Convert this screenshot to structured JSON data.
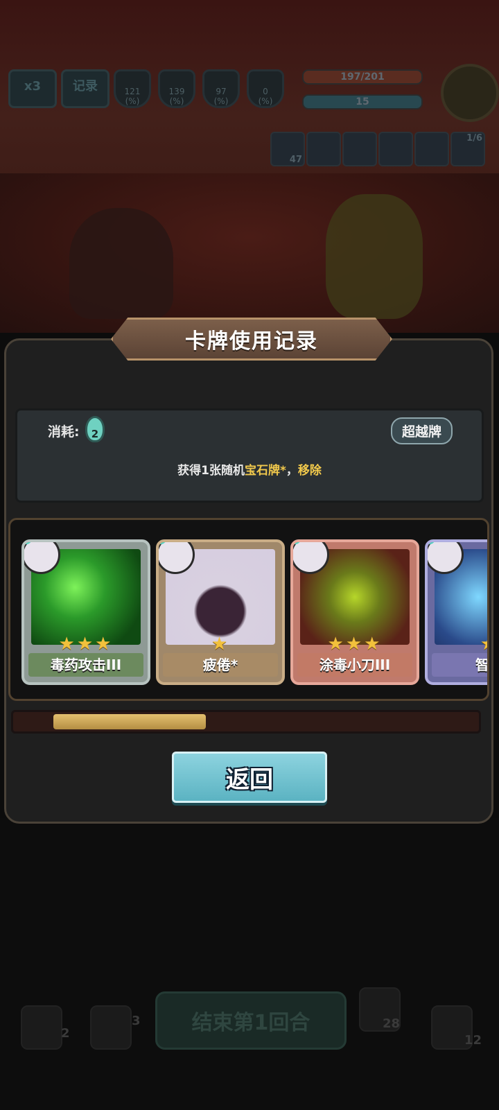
{
  "hud": {
    "speed_label": "x3",
    "record_label": "记录",
    "stats": [
      {
        "value": "121",
        "unit": "(%)"
      },
      {
        "value": "139",
        "unit": "(%)"
      },
      {
        "value": "97",
        "unit": "(%)"
      },
      {
        "value": "0",
        "unit": "(%)"
      }
    ],
    "hp_text": "197/201",
    "energy_text": "15",
    "relic_count": "47",
    "relic_page": "1/6"
  },
  "dialog": {
    "title": "卡牌使用记录",
    "cost_label": "消耗:",
    "cost_value": "2",
    "badge": "超越牌",
    "effect_prefix": "获得1张随机",
    "effect_highlight1": "宝石牌*",
    "effect_mid": "，",
    "effect_highlight2": "移除",
    "cards": [
      {
        "name": "毒药攻击III",
        "stars": "★★★"
      },
      {
        "name": "疲倦*",
        "stars": "★"
      },
      {
        "name": "涂毒小刀III",
        "stars": "★★★"
      },
      {
        "name": "智慧",
        "stars": "★"
      }
    ],
    "scroll_progress": 0.35,
    "return_label": "返回"
  },
  "bottom": {
    "draw_pile": "2",
    "discard_count": "3",
    "end_turn_label": "结束第1回合",
    "potion_count": "28",
    "exhaust_count": "12"
  },
  "colors": {
    "highlight": "#f2c94c",
    "return_button": "#6cc0cd",
    "panel": "#1f1f1f"
  }
}
